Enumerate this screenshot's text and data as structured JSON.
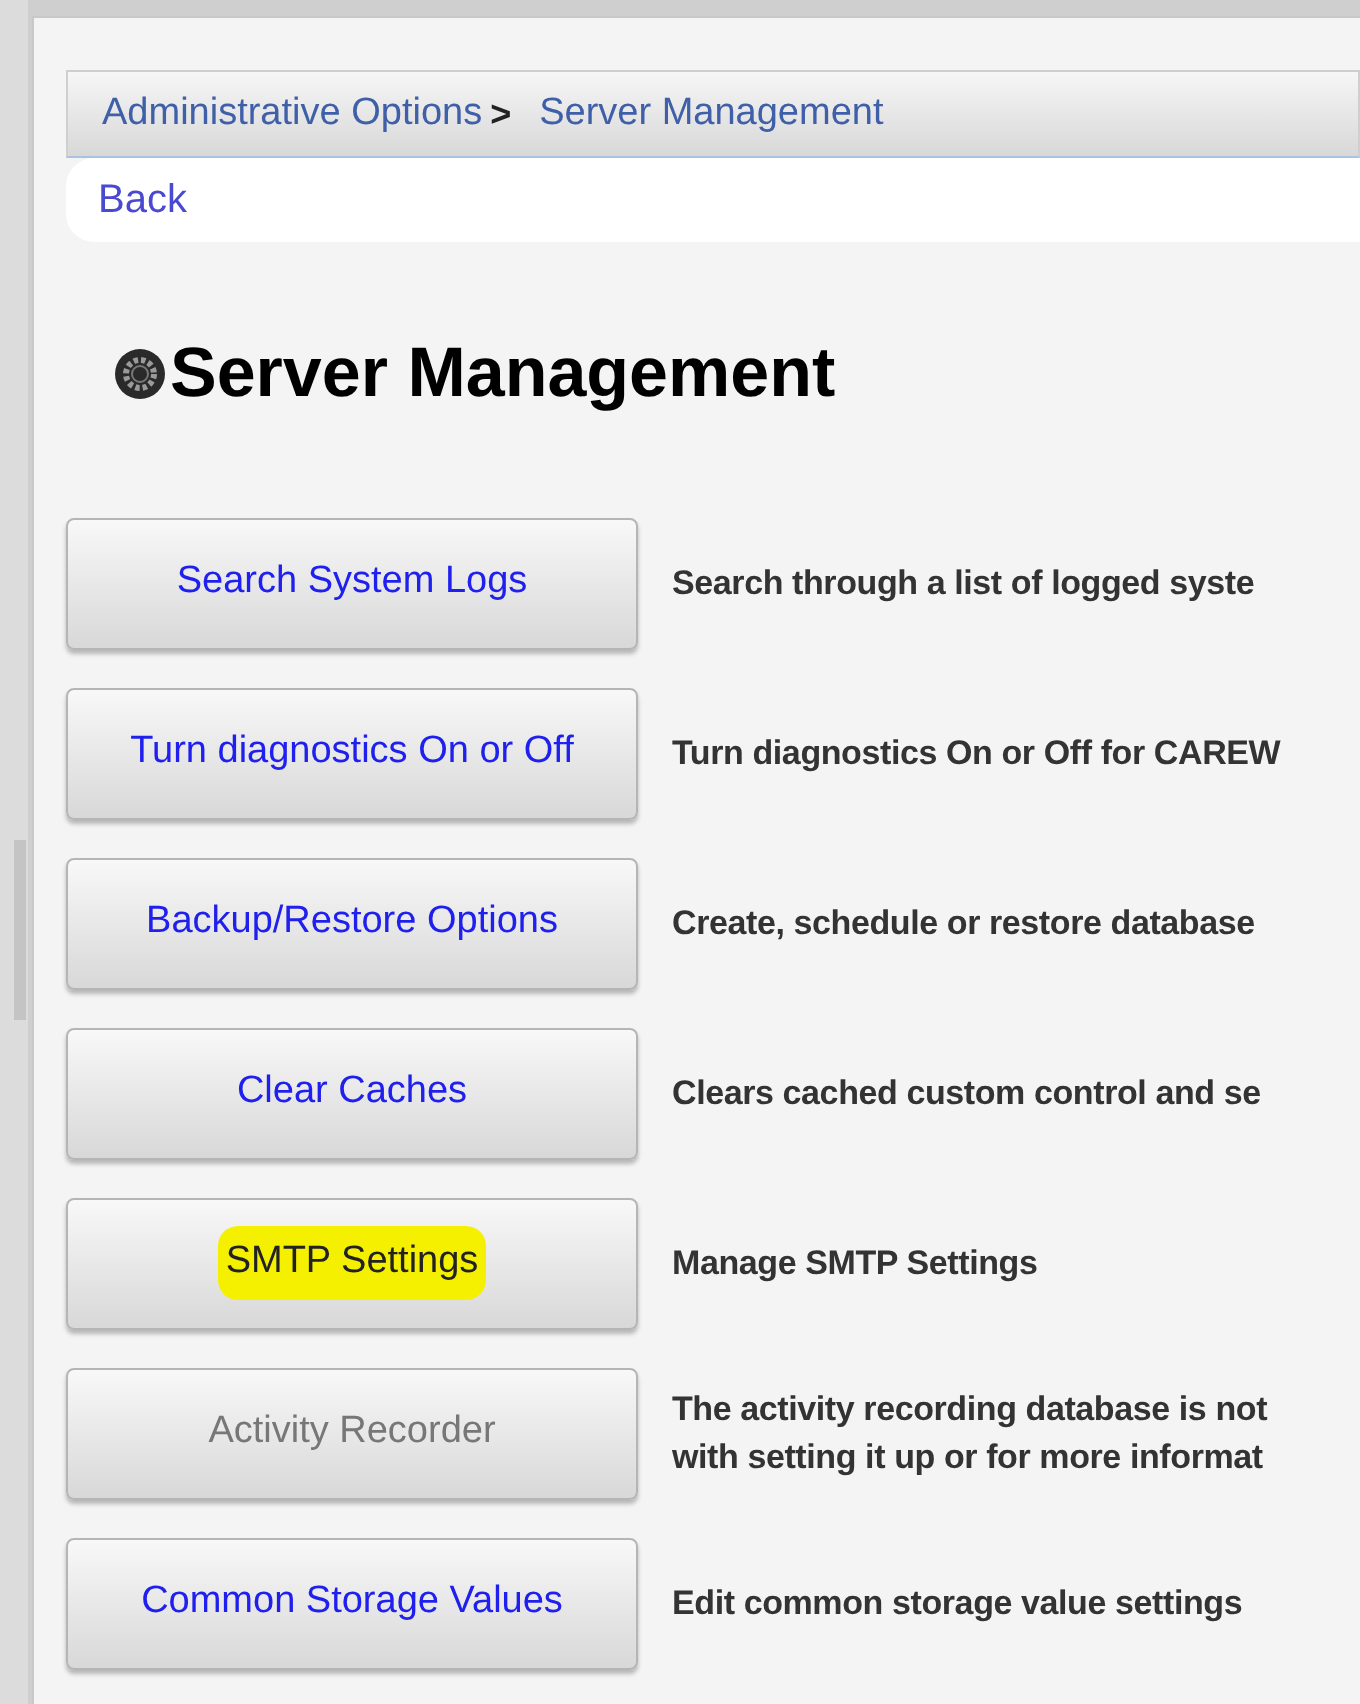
{
  "breadcrumb": {
    "items": [
      {
        "label": "Administrative Options"
      },
      {
        "label": "Server Management"
      }
    ],
    "separator": ">"
  },
  "back_link": "Back",
  "title": "Server Management",
  "options": [
    {
      "button": "Search System Logs",
      "description": [
        "Search through a list of logged syste"
      ],
      "disabled": false,
      "highlighted": false
    },
    {
      "button": "Turn diagnostics On or Off",
      "description": [
        "Turn diagnostics On or Off for CAREW"
      ],
      "disabled": false,
      "highlighted": false
    },
    {
      "button": "Backup/Restore Options",
      "description": [
        "Create, schedule or restore database"
      ],
      "disabled": false,
      "highlighted": false
    },
    {
      "button": "Clear Caches",
      "description": [
        "Clears cached custom control and se"
      ],
      "disabled": false,
      "highlighted": false
    },
    {
      "button": "SMTP Settings",
      "description": [
        "Manage SMTP Settings"
      ],
      "disabled": false,
      "highlighted": true
    },
    {
      "button": "Activity Recorder",
      "description": [
        "The activity recording database is not",
        "with setting it up or for more informat"
      ],
      "disabled": true,
      "highlighted": false
    },
    {
      "button": "Common Storage Values",
      "description": [
        "Edit common storage value settings"
      ],
      "disabled": false,
      "highlighted": false
    }
  ]
}
